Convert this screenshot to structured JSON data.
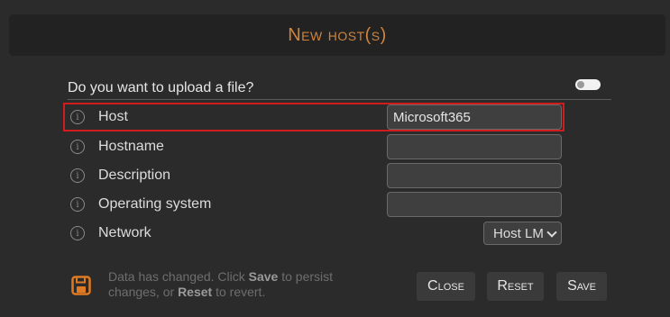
{
  "dialog": {
    "title": "New host(s)"
  },
  "upload": {
    "label": "Do you want to upload a file?",
    "toggle_on": false
  },
  "fields": {
    "host": {
      "label": "Host",
      "value": "Microsoft365"
    },
    "hostname": {
      "label": "Hostname",
      "value": ""
    },
    "description": {
      "label": "Description",
      "value": ""
    },
    "os": {
      "label": "Operating system",
      "value": ""
    },
    "network": {
      "label": "Network",
      "selected": "Host LM"
    }
  },
  "info_icon_glyph": "i",
  "status": {
    "part1": "Data has changed. Click ",
    "save_word": "Save",
    "part2": " to persist changes, or ",
    "reset_word": "Reset",
    "part3": " to revert."
  },
  "buttons": {
    "close": "Close",
    "reset": "Reset",
    "save": "Save"
  },
  "colors": {
    "accent": "#d0843a",
    "highlight_border": "#d01c1c",
    "background": "#2b2b2b"
  },
  "icons": [
    "info-icon",
    "floppy-save-icon",
    "chevron-down-icon"
  ]
}
